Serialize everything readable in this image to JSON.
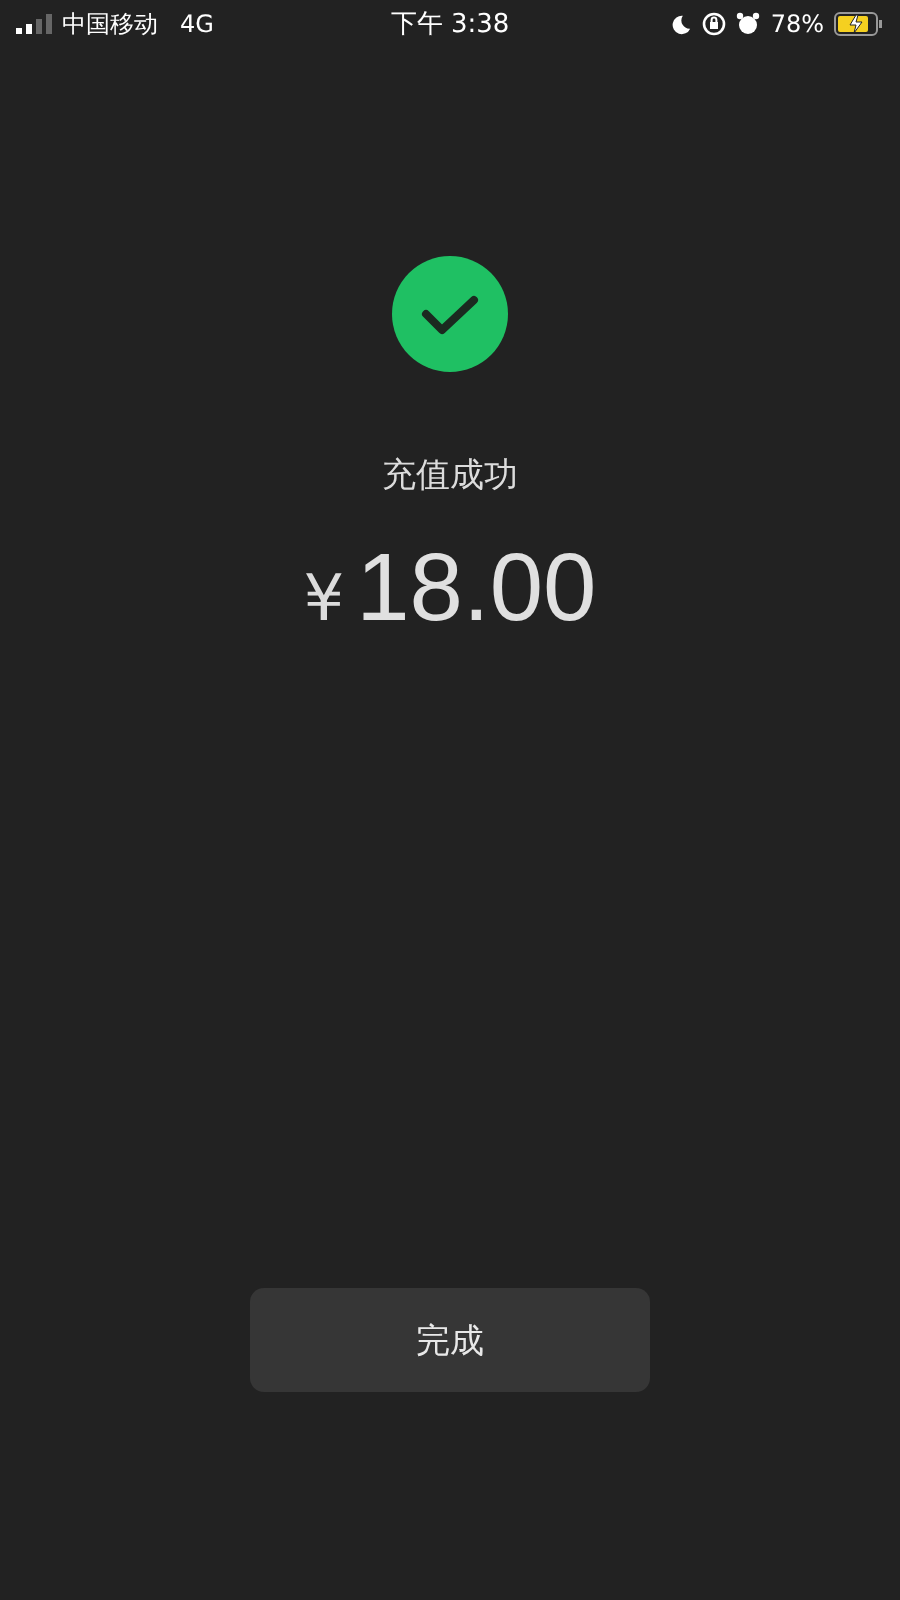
{
  "status_bar": {
    "carrier": "中国移动",
    "network": "4G",
    "time": "下午 3:38",
    "battery": "78%"
  },
  "result": {
    "title": "充值成功",
    "currency": "¥",
    "amount": "18.00"
  },
  "done_button": {
    "label": "完成"
  }
}
